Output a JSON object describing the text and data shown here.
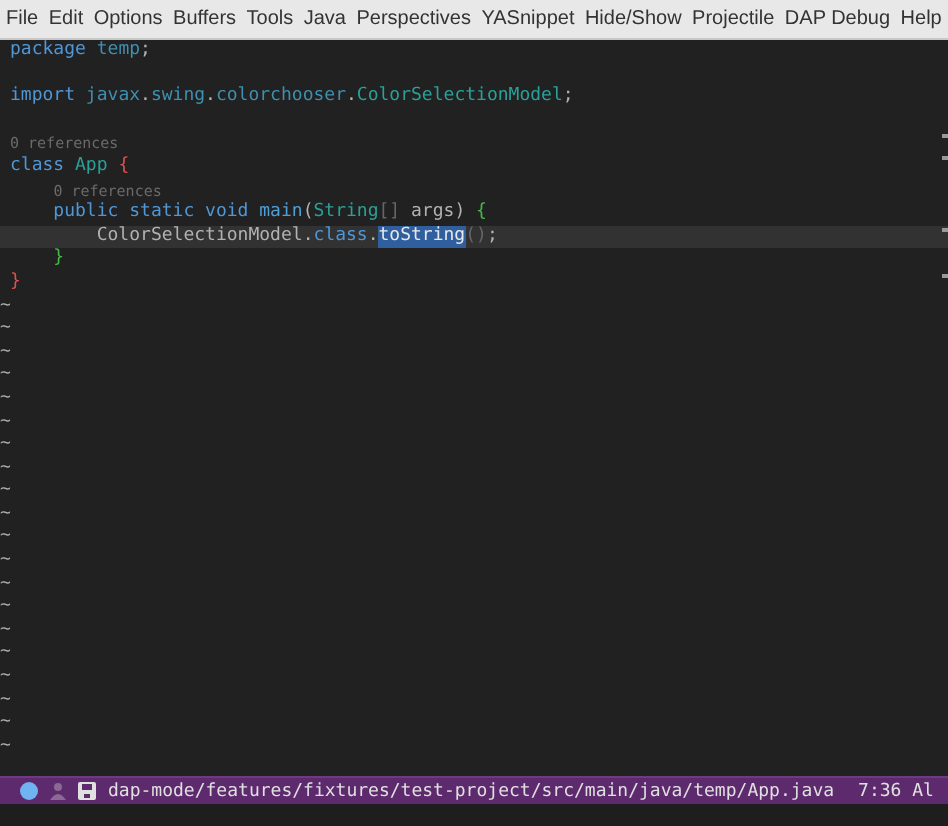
{
  "menu_bar": {
    "items": [
      "File",
      "Edit",
      "Options",
      "Buffers",
      "Tools",
      "Java",
      "Perspectives",
      "YASnippet",
      "Hide/Show",
      "Projectile",
      "DAP Debug",
      "Help"
    ]
  },
  "editor": {
    "lines": [
      {
        "kind": "code",
        "current": false,
        "tokens": [
          {
            "text": "package",
            "kind": "keyword"
          },
          {
            "text": " temp",
            "kind": "namespace"
          },
          {
            "text": ";",
            "kind": "plain"
          }
        ]
      },
      {
        "kind": "blank"
      },
      {
        "kind": "code",
        "current": false,
        "tokens": [
          {
            "text": "import",
            "kind": "keyword"
          },
          {
            "text": " javax",
            "kind": "namespace"
          },
          {
            "text": ".",
            "kind": "plain"
          },
          {
            "text": "swing",
            "kind": "namespace"
          },
          {
            "text": ".",
            "kind": "plain"
          },
          {
            "text": "colorchooser",
            "kind": "namespace"
          },
          {
            "text": ".",
            "kind": "plain"
          },
          {
            "text": "ColorSelectionModel",
            "kind": "type"
          },
          {
            "text": ";",
            "kind": "plain"
          }
        ]
      },
      {
        "kind": "blank"
      },
      {
        "kind": "code",
        "current": false,
        "lens": "0 references",
        "tokens": [
          {
            "text": "class",
            "kind": "keyword"
          },
          {
            "text": " App",
            "kind": "type"
          },
          {
            "text": " {",
            "kind": "brace1"
          }
        ]
      },
      {
        "kind": "code",
        "current": false,
        "lens": "0 references",
        "tokens": [
          {
            "text": "    public",
            "kind": "keyword"
          },
          {
            "text": " static",
            "kind": "keyword"
          },
          {
            "text": " void",
            "kind": "keyword"
          },
          {
            "text": " main",
            "kind": "function"
          },
          {
            "text": "(",
            "kind": "plain"
          },
          {
            "text": "String",
            "kind": "type"
          },
          {
            "text": "[]",
            "kind": "dim"
          },
          {
            "text": " args",
            "kind": "plain"
          },
          {
            "text": ")",
            "kind": "plain"
          },
          {
            "text": " {",
            "kind": "brace2"
          }
        ]
      },
      {
        "kind": "code",
        "current": true,
        "tokens": [
          {
            "text": "        ColorSelectionModel",
            "kind": "plain"
          },
          {
            "text": ".",
            "kind": "plain"
          },
          {
            "text": "class",
            "kind": "keyword"
          },
          {
            "text": ".",
            "kind": "plain"
          },
          {
            "text": "toString",
            "kind": "selection"
          },
          {
            "text": "()",
            "kind": "dim"
          },
          {
            "text": ";",
            "kind": "plain"
          }
        ]
      },
      {
        "kind": "code",
        "current": false,
        "tokens": [
          {
            "text": "    }",
            "kind": "brace2"
          }
        ]
      },
      {
        "kind": "code",
        "current": false,
        "tokens": [
          {
            "text": "}",
            "kind": "brace1"
          }
        ]
      }
    ],
    "empty_line_markers": [
      "~",
      "~",
      "~",
      "~",
      "~",
      "~",
      "~",
      "~",
      "~",
      "~",
      "~",
      "~",
      "~",
      "~",
      "~",
      "~",
      "~",
      "~",
      "~",
      "~"
    ]
  },
  "mode_line": {
    "path": "dap-mode/features/fixtures/test-project/src/main/java/temp/App.java",
    "time": "7:36 Al"
  }
}
